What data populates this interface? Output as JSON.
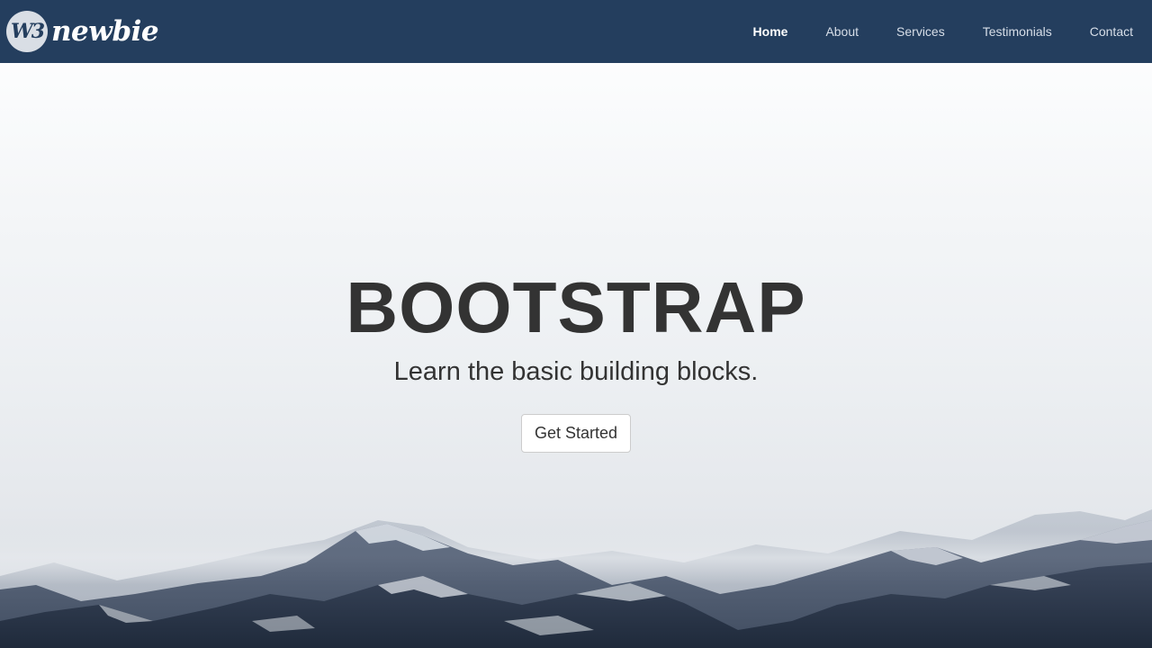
{
  "brand": {
    "badge": "W3",
    "name": "newbie"
  },
  "nav": {
    "items": [
      {
        "label": "Home",
        "active": true
      },
      {
        "label": "About",
        "active": false
      },
      {
        "label": "Services",
        "active": false
      },
      {
        "label": "Testimonials",
        "active": false
      },
      {
        "label": "Contact",
        "active": false
      }
    ]
  },
  "hero": {
    "title": "BOOTSTRAP",
    "subtitle": "Learn the basic building blocks.",
    "cta_label": "Get Started"
  },
  "colors": {
    "navbar": "#243e5e",
    "text": "#333333"
  }
}
